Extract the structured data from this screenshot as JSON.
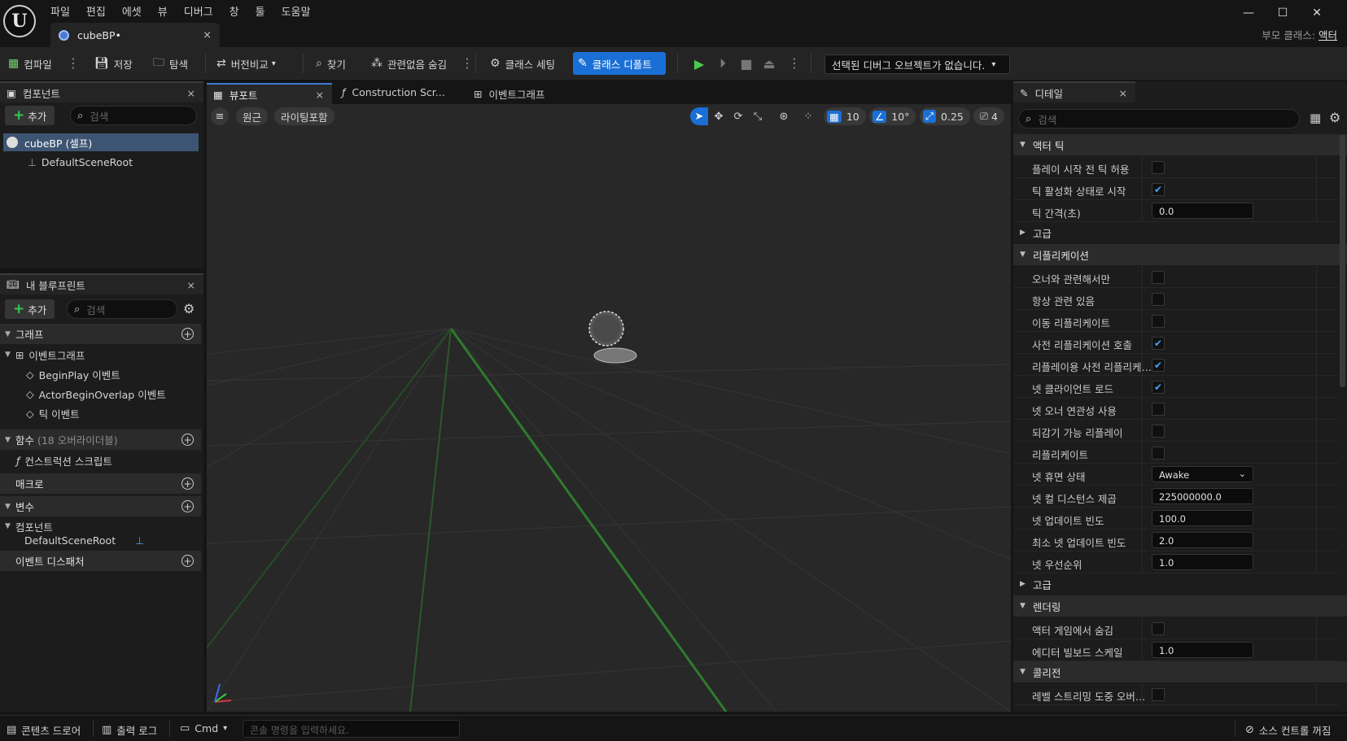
{
  "menu": [
    "파일",
    "편집",
    "에셋",
    "뷰",
    "디버그",
    "창",
    "툴",
    "도움말"
  ],
  "doc_tab": {
    "name": "cubeBP•",
    "close": "×"
  },
  "window_controls": {
    "minimize": "—",
    "maximize": "☐",
    "close": "✕"
  },
  "parent_class": {
    "label": "부모 클래스:",
    "value": "액터"
  },
  "toolbar": {
    "compile": "컴파일",
    "save": "저장",
    "browse": "탐색",
    "diff": "버전비교",
    "find": "찾기",
    "hide_unrelated": "관련없음 숨김",
    "class_settings": "클래스 세팅",
    "class_defaults": "클래스 디폴트",
    "debug_object": "선택된 디버그 오브젝트가 없습니다."
  },
  "components_panel": {
    "tab": "컴포넌트",
    "add": "추가",
    "search_placeholder": "검색",
    "items": [
      {
        "label": "cubeBP (셀프)"
      },
      {
        "label": "DefaultSceneRoot"
      }
    ]
  },
  "my_blueprint": {
    "tab": "내 블루프린트",
    "add": "추가",
    "search_placeholder": "검색",
    "graphs_header": "그래프",
    "event_graph": "이벤트그래프",
    "events": [
      "BeginPlay 이벤트",
      "ActorBeginOverlap 이벤트",
      "틱 이벤트"
    ],
    "functions_header": "함수",
    "functions_count": "(18 오버라이더블)",
    "construction_script": "컨스트럭션 스크립트",
    "macros_header": "매크로",
    "variables_header": "변수",
    "components_group": "컴포넌트",
    "default_scene_root": "DefaultSceneRoot",
    "event_dispatchers_header": "이벤트 디스패처"
  },
  "editor_tabs": {
    "viewport": "뷰포트",
    "construction": "Construction Scr...",
    "event_graph": "이벤트그래프"
  },
  "viewport": {
    "perspective": "원근",
    "lit": "라이팅포함",
    "grid_snap": "10",
    "rot_snap": "10°",
    "scale_snap": "0.25",
    "camera_speed": "4"
  },
  "details": {
    "tab": "디테일",
    "search_placeholder": "검색",
    "sections": {
      "actor_tick": "액터 틱",
      "advanced": "고급",
      "replication": "리플리케이션",
      "rendering": "렌더링",
      "collision": "콜리전"
    },
    "rows": {
      "tick_before_begin": "플레이 시작 전 틱 허용",
      "start_with_tick": "틱 활성화 상태로 시작",
      "tick_interval": "틱 간격(초)",
      "tick_interval_value": "0.0",
      "only_relevant_to_owner": "오너와 관련해서만",
      "always_relevant": "항상 관련 있음",
      "replicate_movement": "이동 리플리케이트",
      "call_pre_replication": "사전 리플리케이션 호출",
      "call_pre_replication_replay": "리플레이용 사전 리플리케이...",
      "net_load_on_client": "넷 클라이언트 로드",
      "net_use_owner_relevancy": "넷 오너 연관성 사용",
      "replay_rewindable": "되감기 가능 리플레이",
      "replicates": "리플리케이트",
      "net_dormancy": "넷 휴면 상태",
      "net_dormancy_value": "Awake",
      "net_cull_distance": "넷 컬 디스턴스 제곱",
      "net_cull_distance_value": "225000000.0",
      "net_update_freq": "넷 업데이트 빈도",
      "net_update_freq_value": "100.0",
      "min_net_update_freq": "최소 넷 업데이트 빈도",
      "min_net_update_freq_value": "2.0",
      "net_priority": "넷 우선순위",
      "net_priority_value": "1.0",
      "hidden_in_game": "액터 게임에서 숨김",
      "editor_billboard_scale": "에디터 빌보드 스케일",
      "editor_billboard_scale_value": "1.0",
      "level_streaming_overlap": "레벨 스트리밍 도중 오버랩..."
    }
  },
  "statusbar": {
    "content_drawer": "콘텐츠 드로어",
    "output_log": "출력 로그",
    "cmd": "Cmd",
    "console_placeholder": "콘솔 명령을 입력하세요.",
    "source_control": "소스 컨트롤 꺼짐"
  }
}
